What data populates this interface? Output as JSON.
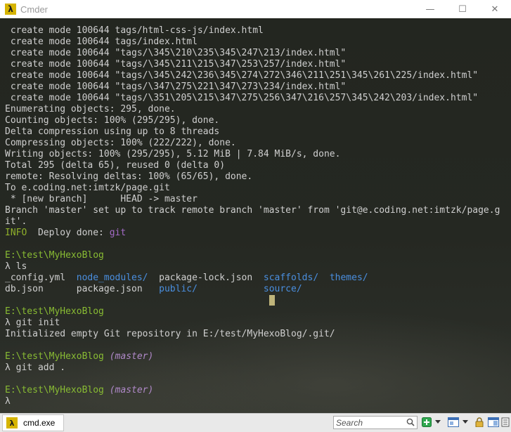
{
  "window": {
    "title": "Cmder",
    "app_icon": "lambda-icon",
    "app_icon_glyph": "λ",
    "controls": {
      "minimize": "—",
      "maximize": "☐",
      "close": "✕"
    }
  },
  "terminal": {
    "lines": [
      [
        [
          "default",
          " create mode 100644 tags/html-css-js/index.html"
        ]
      ],
      [
        [
          "default",
          " create mode 100644 tags/index.html"
        ]
      ],
      [
        [
          "default",
          " create mode 100644 \"tags/\\345\\210\\235\\345\\247\\213/index.html\""
        ]
      ],
      [
        [
          "default",
          " create mode 100644 \"tags/\\345\\211\\215\\347\\253\\257/index.html\""
        ]
      ],
      [
        [
          "default",
          " create mode 100644 \"tags/\\345\\242\\236\\345\\274\\272\\346\\211\\251\\345\\261\\225/index.html\""
        ]
      ],
      [
        [
          "default",
          " create mode 100644 \"tags/\\347\\275\\221\\347\\273\\234/index.html\""
        ]
      ],
      [
        [
          "default",
          " create mode 100644 \"tags/\\351\\205\\215\\347\\275\\256\\347\\216\\257\\345\\242\\203/index.html\""
        ]
      ],
      [
        [
          "default",
          "Enumerating objects: 295, done."
        ]
      ],
      [
        [
          "default",
          "Counting objects: 100% (295/295), done."
        ]
      ],
      [
        [
          "default",
          "Delta compression using up to 8 threads"
        ]
      ],
      [
        [
          "default",
          "Compressing objects: 100% (222/222), done."
        ]
      ],
      [
        [
          "default",
          "Writing objects: 100% (295/295), 5.12 MiB | 7.84 MiB/s, done."
        ]
      ],
      [
        [
          "default",
          "Total 295 (delta 65), reused 0 (delta 0)"
        ]
      ],
      [
        [
          "default",
          "remote: Resolving deltas: 100% (65/65), done."
        ]
      ],
      [
        [
          "default",
          "To e.coding.net:imtzk/page.git"
        ]
      ],
      [
        [
          "default",
          " * [new branch]      HEAD -> master"
        ]
      ],
      [
        [
          "default",
          "Branch 'master' set up to track remote branch 'master' from 'git@e.coding.net:imtzk/page.g"
        ]
      ],
      [
        [
          "default",
          "it'."
        ]
      ],
      [
        [
          "info",
          "INFO"
        ],
        [
          "default",
          "  Deploy done: "
        ],
        [
          "git",
          "git"
        ]
      ],
      [
        [
          "default",
          ""
        ]
      ],
      [
        [
          "path",
          "E:\\test\\MyHexoBlog"
        ]
      ],
      [
        [
          "default",
          "λ ls"
        ]
      ],
      [
        [
          "default",
          "_config.yml  "
        ],
        [
          "dir",
          "node_modules/"
        ],
        [
          "default",
          "  package-lock.json  "
        ],
        [
          "dir",
          "scaffolds/"
        ],
        [
          "default",
          "  "
        ],
        [
          "dir",
          "themes/"
        ]
      ],
      [
        [
          "default",
          "db.json      package.json   "
        ],
        [
          "dir",
          "public/"
        ],
        [
          "default",
          "            "
        ],
        [
          "dir",
          "source/"
        ]
      ],
      [
        [
          "default",
          ""
        ]
      ],
      [
        [
          "path",
          "E:\\test\\MyHexoBlog"
        ]
      ],
      [
        [
          "default",
          "λ git init"
        ]
      ],
      [
        [
          "default",
          "Initialized empty Git repository in E:/test/MyHexoBlog/.git/"
        ]
      ],
      [
        [
          "default",
          ""
        ]
      ],
      [
        [
          "path",
          "E:\\test\\MyHexoBlog "
        ],
        [
          "branch",
          "(master)"
        ]
      ],
      [
        [
          "default",
          "λ git add ."
        ]
      ],
      [
        [
          "default",
          ""
        ]
      ],
      [
        [
          "path",
          "E:\\test\\MyHexoBlog "
        ],
        [
          "branch",
          "(master)"
        ]
      ],
      [
        [
          "default",
          "λ"
        ]
      ]
    ]
  },
  "taskbar": {
    "tab_label": "cmd.exe",
    "tab_icon": "lambda-icon",
    "search_placeholder": "Search",
    "icons": [
      "search-icon",
      "add-console-icon",
      "dropdown-icon",
      "layout-icon",
      "dropdown-icon",
      "lock-icon",
      "layout-icon",
      "menu-icon"
    ]
  },
  "colors": {
    "default_text": "#cfcfcf",
    "path": "#88bb33",
    "branch": "#b089c9",
    "dir": "#4a8fe0",
    "info": "#8fb02a",
    "git": "#a46bc7",
    "cursor": "#bfb47a",
    "accent": "#d6b400"
  }
}
